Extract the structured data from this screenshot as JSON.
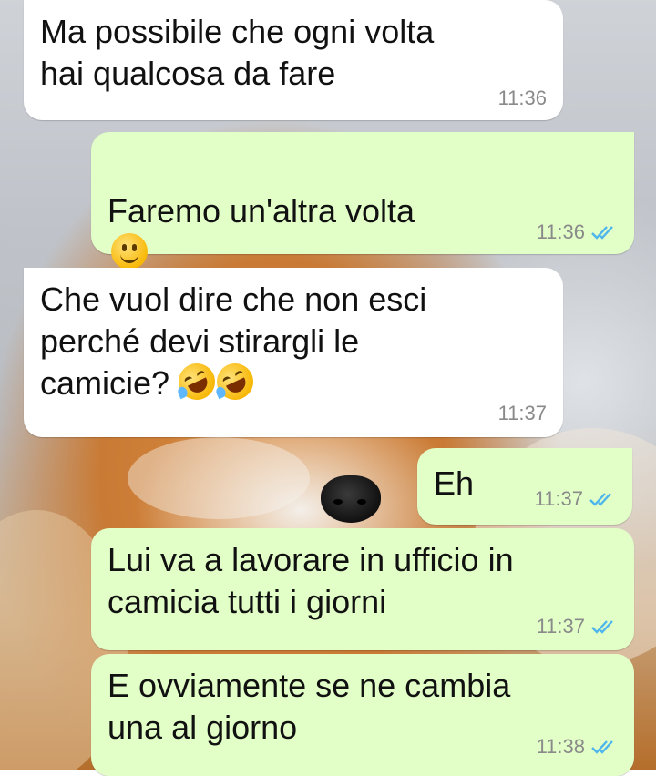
{
  "chat": {
    "messages": [
      {
        "direction": "incoming",
        "text": "Ma possibile che ogni volta\nhai qualcosa da fare",
        "time": "11:36",
        "emoji": ""
      },
      {
        "direction": "outgoing",
        "text": "Faremo un'altra volta",
        "time": "11:36",
        "emoji": "slightly-smiling-face",
        "status": "read"
      },
      {
        "direction": "incoming",
        "text": "Che vuol dire che non esci\nperché devi stirargli le\ncamicie?",
        "time": "11:37",
        "emoji": "rolling-on-floor-laughing x2"
      },
      {
        "direction": "outgoing",
        "text": "Eh",
        "time": "11:37",
        "status": "read"
      },
      {
        "direction": "outgoing",
        "text": "Lui va a lavorare in ufficio in\ncamicia tutti i giorni",
        "time": "11:37",
        "status": "read"
      },
      {
        "direction": "outgoing",
        "text": "E ovviamente se ne cambia\nuna al giorno",
        "time": "11:38",
        "status": "read"
      }
    ]
  },
  "colors": {
    "incoming_bubble": "#ffffff",
    "outgoing_bubble": "#e2ffc7",
    "read_ticks": "#4fb6ec",
    "time_text": "#8a8a8a"
  },
  "icons": [
    "double-check-icon",
    "slightly-smiling-face-emoji",
    "rolling-on-floor-laughing-emoji"
  ]
}
